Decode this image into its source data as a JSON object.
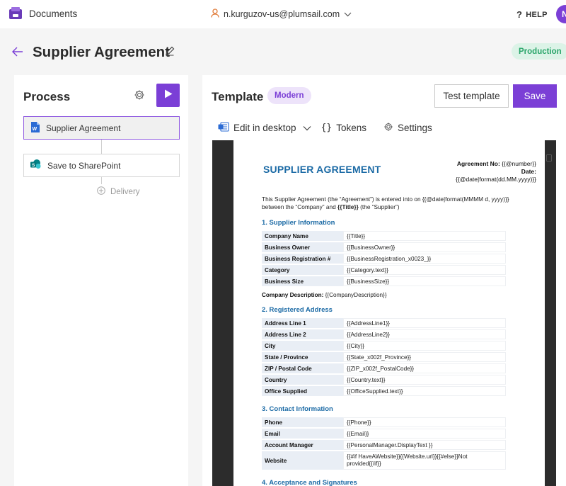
{
  "app": {
    "name": "Documents"
  },
  "account": {
    "email": "n.kurguzov-us@plumsail.com"
  },
  "help": {
    "label": "HELP"
  },
  "avatar": {
    "initial": "N"
  },
  "header": {
    "title": "Supplier Agreement",
    "status_badge": "Production"
  },
  "process": {
    "title": "Process",
    "steps": [
      {
        "label": "Supplier Agreement"
      },
      {
        "label": "Save to SharePoint"
      }
    ],
    "delivery_label": "Delivery"
  },
  "template": {
    "title": "Template",
    "badge": "Modern",
    "test_label": "Test template",
    "save_label": "Save",
    "toolbar": {
      "edit_desktop": "Edit in desktop",
      "tokens": "Tokens",
      "settings": "Settings"
    }
  },
  "document": {
    "title": "SUPPLIER AGREEMENT",
    "agreement_no_label": "Agreement No:",
    "agreement_no_value": "{{@number}}",
    "date_label": "Date:",
    "date_value": "{{@date|format(dd.MM.yyyy)}}",
    "intro_1": "This Supplier Agreement (the “Agreement”) is entered into on {{@date|format(MMMM d, yyyy)}} between the “Company” and ",
    "intro_bold": "{{Title}}",
    "intro_2": " (the “Supplier”)",
    "sections": [
      {
        "title": "1. Supplier Information",
        "rows": [
          {
            "k": "Company Name",
            "v": "{{Title}}"
          },
          {
            "k": "Business Owner",
            "v": "{{BusinessOwner}}"
          },
          {
            "k": "Business Registration #",
            "v": "{{BusinessRegistration_x0023_}}"
          },
          {
            "k": "Category",
            "v": "{{Category.text}}"
          },
          {
            "k": "Business Size",
            "v": "{{BusinessSize}}"
          }
        ]
      },
      {
        "title": "2. Registered Address",
        "rows": [
          {
            "k": "Address Line 1",
            "v": "{{AddressLine1}}"
          },
          {
            "k": "Address Line 2",
            "v": "{{AddressLine2}}"
          },
          {
            "k": "City",
            "v": "{{City}}"
          },
          {
            "k": "State / Province",
            "v": "{{State_x002f_Province}}"
          },
          {
            "k": "ZIP / Postal Code",
            "v": "{{ZIP_x002f_PostalCode}}"
          },
          {
            "k": "Country",
            "v": "{{Country.text}}"
          },
          {
            "k": "Office Supplied",
            "v": "{{OfficeSupplied.text}}"
          }
        ]
      },
      {
        "title": "3. Contact Information",
        "rows": [
          {
            "k": "Phone",
            "v": "{{Phone}}"
          },
          {
            "k": "Email",
            "v": "{{Email}}"
          },
          {
            "k": "Account Manager",
            "v": "{{PersonalManager.DisplayText }}"
          },
          {
            "k": "Website",
            "v": "{{#if HaveAWebsite}}{{Website.url}}{{#else}}Not provided{{/if}}"
          }
        ]
      },
      {
        "title": "4. Acceptance and Signatures",
        "rows": []
      }
    ],
    "company_description_label": "Company Description:",
    "company_description_value": "{{CompanyDescription}}"
  },
  "colors": {
    "accent": "#7b3fd6",
    "production": "#2aa56a",
    "doc_heading": "#1b6aa5"
  }
}
